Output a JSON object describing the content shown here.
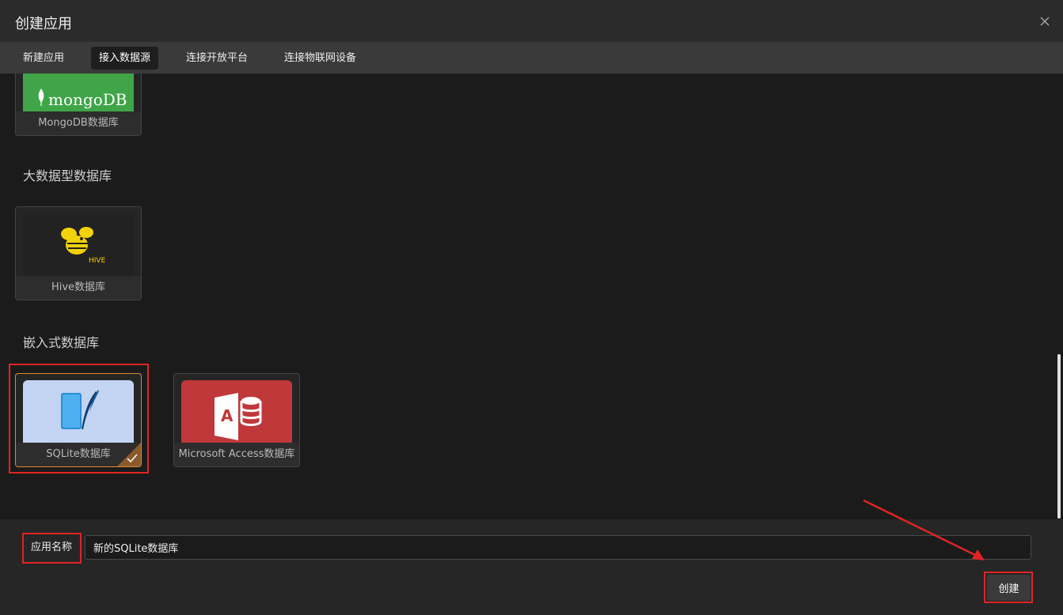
{
  "dialog": {
    "title": "创建应用"
  },
  "tabs": [
    {
      "label": "新建应用"
    },
    {
      "label": "接入数据源",
      "active": true
    },
    {
      "label": "连接开放平台"
    },
    {
      "label": "连接物联网设备"
    }
  ],
  "sections": {
    "nosql": {
      "cards": [
        {
          "label": "MongoDB数据库",
          "logo_text": "mongoDB"
        }
      ]
    },
    "bigdata": {
      "title": "大数据型数据库",
      "cards": [
        {
          "label": "Hive数据库",
          "logo_text": "HIVE"
        }
      ]
    },
    "embedded": {
      "title": "嵌入式数据库",
      "cards": [
        {
          "label": "SQLite数据库",
          "selected": true
        },
        {
          "label": "Microsoft Access数据库",
          "logo_text": "A"
        }
      ]
    }
  },
  "footer": {
    "name_label": "应用名称",
    "name_value": "新的SQLite数据库",
    "create_label": "创建"
  },
  "colors": {
    "accent_selected": "#e08a33",
    "annotation_red": "#e02424",
    "mongo_green": "#3fa548",
    "access_red": "#c0383a"
  }
}
